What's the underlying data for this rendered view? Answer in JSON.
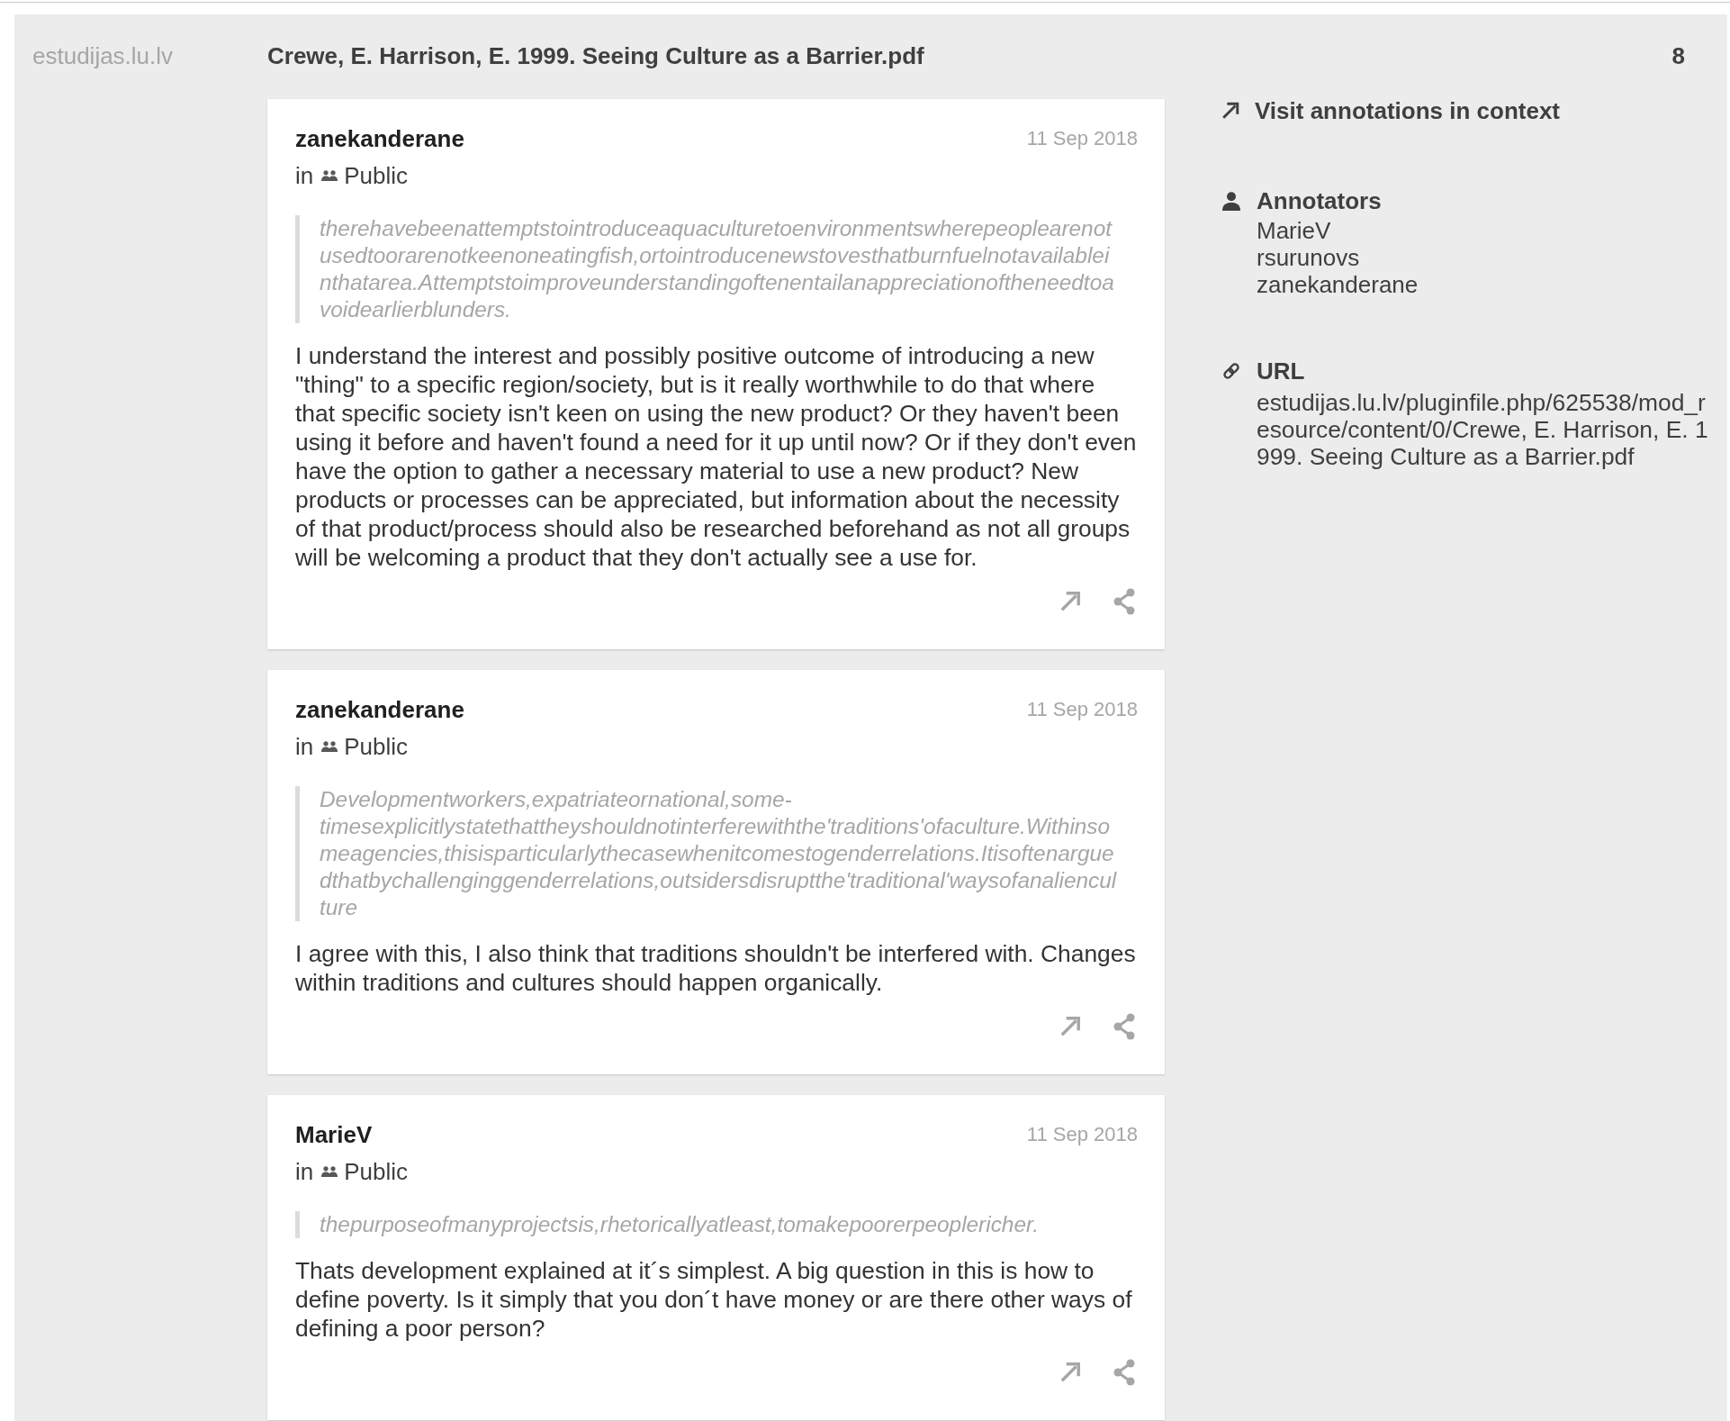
{
  "header": {
    "site": "estudijas.lu.lv",
    "title": "Crewe, E. Harrison, E. 1999. Seeing Culture as a Barrier.pdf",
    "count": "8"
  },
  "annotations": [
    {
      "user": "zanekanderane",
      "date": "11 Sep 2018",
      "scope_prefix": "in",
      "group": "Public",
      "quote": "therehavebeenattemptstointroduceaquaculturetoenvironmentswherepeoplearenotusedtoorarenotkeenoneatingfish,ortointroducenewstovesthatburnfuelnotavailableinthatarea.Attemptstoimproveunderstandingoftenentailanappreciationoftheneedtoavoidearlierblunders.",
      "comment": "I understand the interest and possibly positive outcome of introducing a new \"thing\" to a specific region/society, but is it really worthwhile to do that where that specific society isn't keen on using the new product? Or they haven't been using it before and haven't found a need for it up until now? Or if they don't even have the option to gather a necessary material to use a new product? New products or processes can be appreciated, but information about the necessity of that product/process should also be researched beforehand as not all groups will be welcoming a product that they don't actually see a use for."
    },
    {
      "user": "zanekanderane",
      "date": "11 Sep 2018",
      "scope_prefix": "in",
      "group": "Public",
      "quote": "Developmentworkers,expatriateornational,some-timesexplicitlystatethattheyshouldnotinterferewiththe'traditions'ofaculture.Withinsomeagencies,thisisparticularlythecasewhenitcomestogenderrelations.Itisoftenarguedthatbychallenginggenderrelations,outsidersdisruptthe'traditional'waysofanalienculture",
      "comment": "I agree with this, I also think that traditions shouldn't be interfered with. Changes within traditions and cultures should happen organically."
    },
    {
      "user": "MarieV",
      "date": "11 Sep 2018",
      "scope_prefix": "in",
      "group": "Public",
      "quote": "thepurposeofmanyprojectsis,rhetoricallyatleast,tomakepoorerpeoplericher.",
      "comment": "Thats development explained at it´s simplest. A big question in this is how to define poverty. Is it simply that you don´t have money or are there other ways of defining a poor person?"
    }
  ],
  "sidebar": {
    "visit_link": "Visit annotations in context",
    "annotators": {
      "heading": "Annotators",
      "names": [
        "MarieV",
        "rsurunovs",
        "zanekanderane"
      ]
    },
    "url": {
      "heading": "URL",
      "value": "estudijas.lu.lv/pluginfile.php/625538/mod_resource/content/0/Crewe, E. Harrison, E. 1999. Seeing Culture as a Barrier.pdf"
    }
  }
}
